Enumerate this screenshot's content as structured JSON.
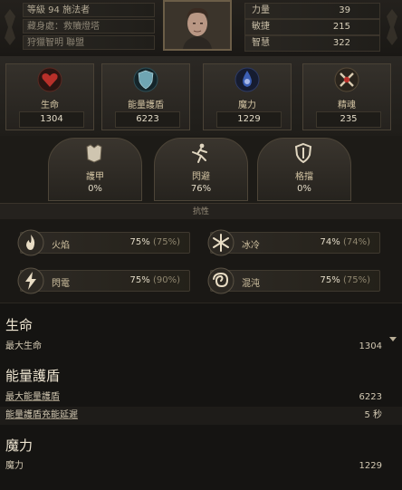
{
  "header": {
    "level_line": "等級 94 施法者",
    "hideout_line": "藏身處：救贖燈塔",
    "guild_line": "狩獵智明 聯盟"
  },
  "attributes": [
    {
      "label": "力量",
      "value": "39"
    },
    {
      "label": "敏捷",
      "value": "215"
    },
    {
      "label": "智慧",
      "value": "322"
    }
  ],
  "core_stats": [
    {
      "label": "生命",
      "value": "1304",
      "icon": "heart-icon"
    },
    {
      "label": "能量護盾",
      "value": "6223",
      "icon": "energy-shield-icon"
    },
    {
      "label": "魔力",
      "value": "1229",
      "icon": "mana-icon"
    },
    {
      "label": "精魂",
      "value": "235",
      "icon": "spirit-icon"
    }
  ],
  "defenses": [
    {
      "label": "護甲",
      "value": "0%",
      "icon": "armour-icon"
    },
    {
      "label": "閃避",
      "value": "76%",
      "icon": "evasion-icon"
    },
    {
      "label": "格擋",
      "value": "0%",
      "icon": "block-icon"
    }
  ],
  "resist_section_label": "抗性",
  "resistances": [
    {
      "label": "火焰",
      "value": "75%",
      "max": "(75%)",
      "icon": "fire-icon"
    },
    {
      "label": "冰冷",
      "value": "74%",
      "max": "(74%)",
      "icon": "cold-icon"
    },
    {
      "label": "閃電",
      "value": "75%",
      "max": "(90%)",
      "icon": "lightning-icon"
    },
    {
      "label": "混沌",
      "value": "75%",
      "max": "(75%)",
      "icon": "chaos-icon"
    }
  ],
  "detail": {
    "life_heading": "生命",
    "max_life_label": "最大生命",
    "max_life_value": "1304",
    "es_heading": "能量護盾",
    "max_es_label": "最大能量護盾",
    "max_es_value": "6223",
    "es_delay_label": "能量護盾充能延遲",
    "es_delay_value": "5 秒",
    "mana_heading": "魔力",
    "mana_label": "魔力",
    "mana_value": "1229"
  },
  "colors": {
    "life": "#b8302a",
    "energy_shield": "#6fa5b3",
    "mana": "#3c5fb4",
    "spirit": "#d9cbb0"
  }
}
